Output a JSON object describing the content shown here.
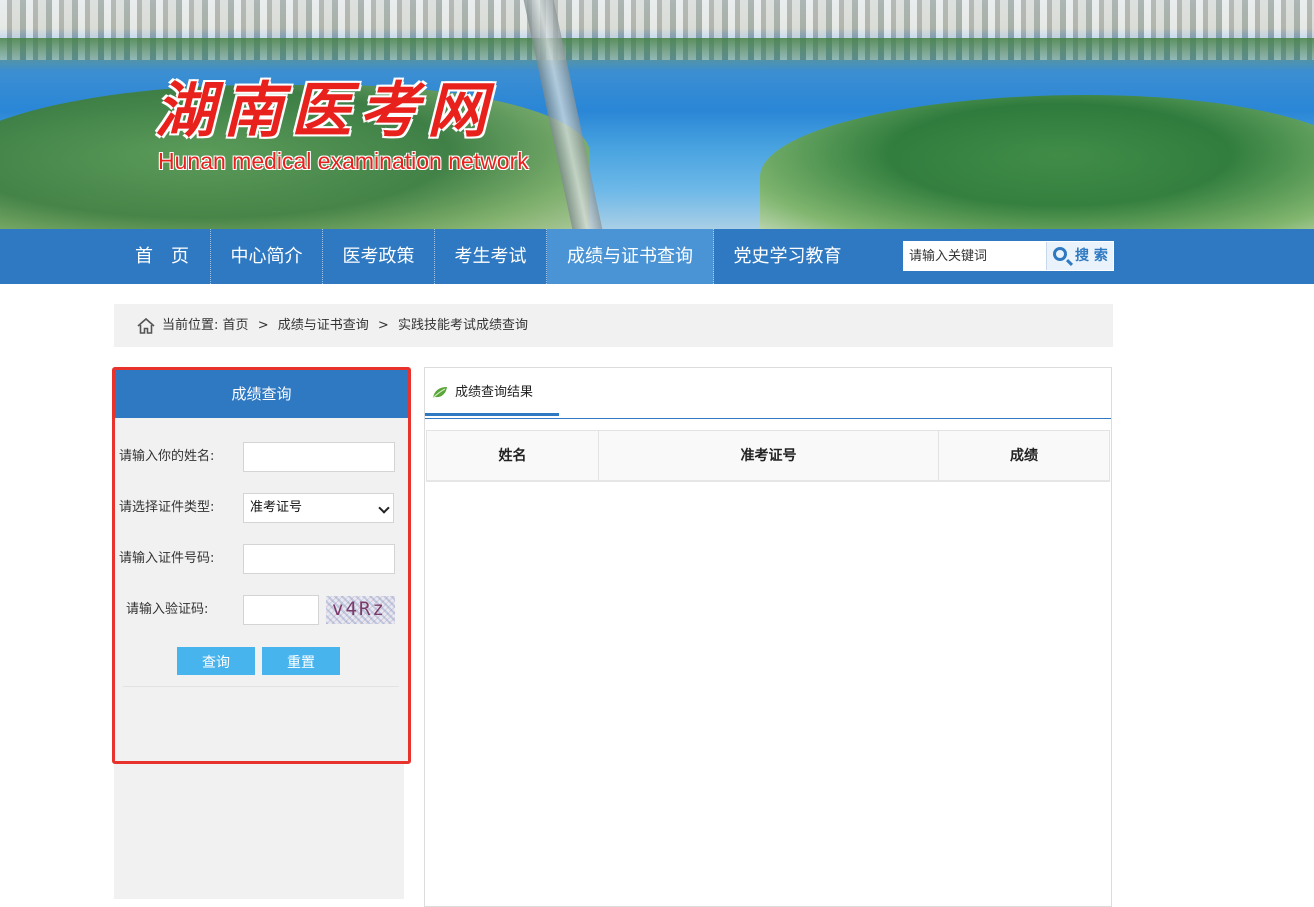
{
  "banner": {
    "logo_cn": "湖南医考网",
    "logo_en": "Hunan medical examination network"
  },
  "nav": {
    "items": [
      {
        "label": "首　页"
      },
      {
        "label": "中心简介"
      },
      {
        "label": "医考政策"
      },
      {
        "label": "考生考试"
      },
      {
        "label": "成绩与证书查询",
        "active": true
      },
      {
        "label": "党史学习教育"
      }
    ],
    "search_placeholder": "请输入关键词",
    "search_button": "搜 索"
  },
  "breadcrumb": {
    "prefix": "当前位置:",
    "items": [
      "首页",
      "成绩与证书查询",
      "实践技能考试成绩查询"
    ],
    "separator": ">"
  },
  "query_form": {
    "title": "成绩查询",
    "name_label": "请输入你的姓名:",
    "name_value": "",
    "id_type_label": "请选择证件类型:",
    "id_type_selected": "准考证号",
    "id_number_label": "请输入证件号码:",
    "id_number_value": "",
    "captcha_label": "请输入验证码:",
    "captcha_value": "",
    "captcha_image_text": "v4Rz",
    "submit_button": "查询",
    "reset_button": "重置"
  },
  "results": {
    "tab_label": "成绩查询结果",
    "columns": [
      "姓名",
      "准考证号",
      "成绩"
    ],
    "rows": []
  },
  "colors": {
    "primary_blue": "#2f79c2",
    "button_blue": "#48b4ee",
    "highlight_red": "#e8322c",
    "logo_red": "#e8211d"
  }
}
